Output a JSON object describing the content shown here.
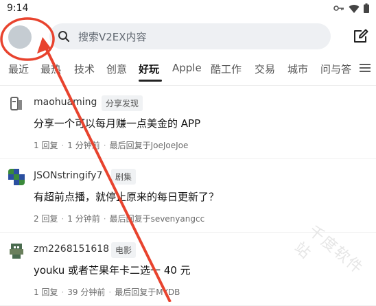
{
  "status": {
    "time": "9:14"
  },
  "search": {
    "placeholder": "搜索V2EX内容"
  },
  "tabs": [
    "最近",
    "最热",
    "技术",
    "创意",
    "好玩",
    "Apple",
    "酷工作",
    "交易",
    "城市",
    "问与答"
  ],
  "active_tab": "好玩",
  "topics": [
    {
      "user": "maohuaming",
      "node": "分享发现",
      "title": "分享一个可以每月赚一点美金的 APP",
      "replies": "1 回复",
      "time": "1 分钟前",
      "last": "最后回复于JoeJoeJoe"
    },
    {
      "user": "JSONstringify7",
      "node": "剧集",
      "title": "有超前点播，就停止原来的每日更新了？",
      "replies": "2 回复",
      "time": "1 分钟前",
      "last": "最后回复于sevenyangcc"
    },
    {
      "user": "zm2268151618",
      "node": "电影",
      "title": "youku 或者芒果年卡二选一 40 元",
      "replies": "1 回复",
      "time": "39 分钟前",
      "last": "最后回复于MYDB"
    }
  ],
  "watermark": "千度软件站",
  "colors": {
    "annotation": "#e8432e",
    "avatar": "#c5ccd2",
    "search_bg": "#eef0f3"
  },
  "icons": [
    "key-icon",
    "wifi-icon",
    "battery-icon",
    "search-icon",
    "compose-icon",
    "menu-icon"
  ]
}
